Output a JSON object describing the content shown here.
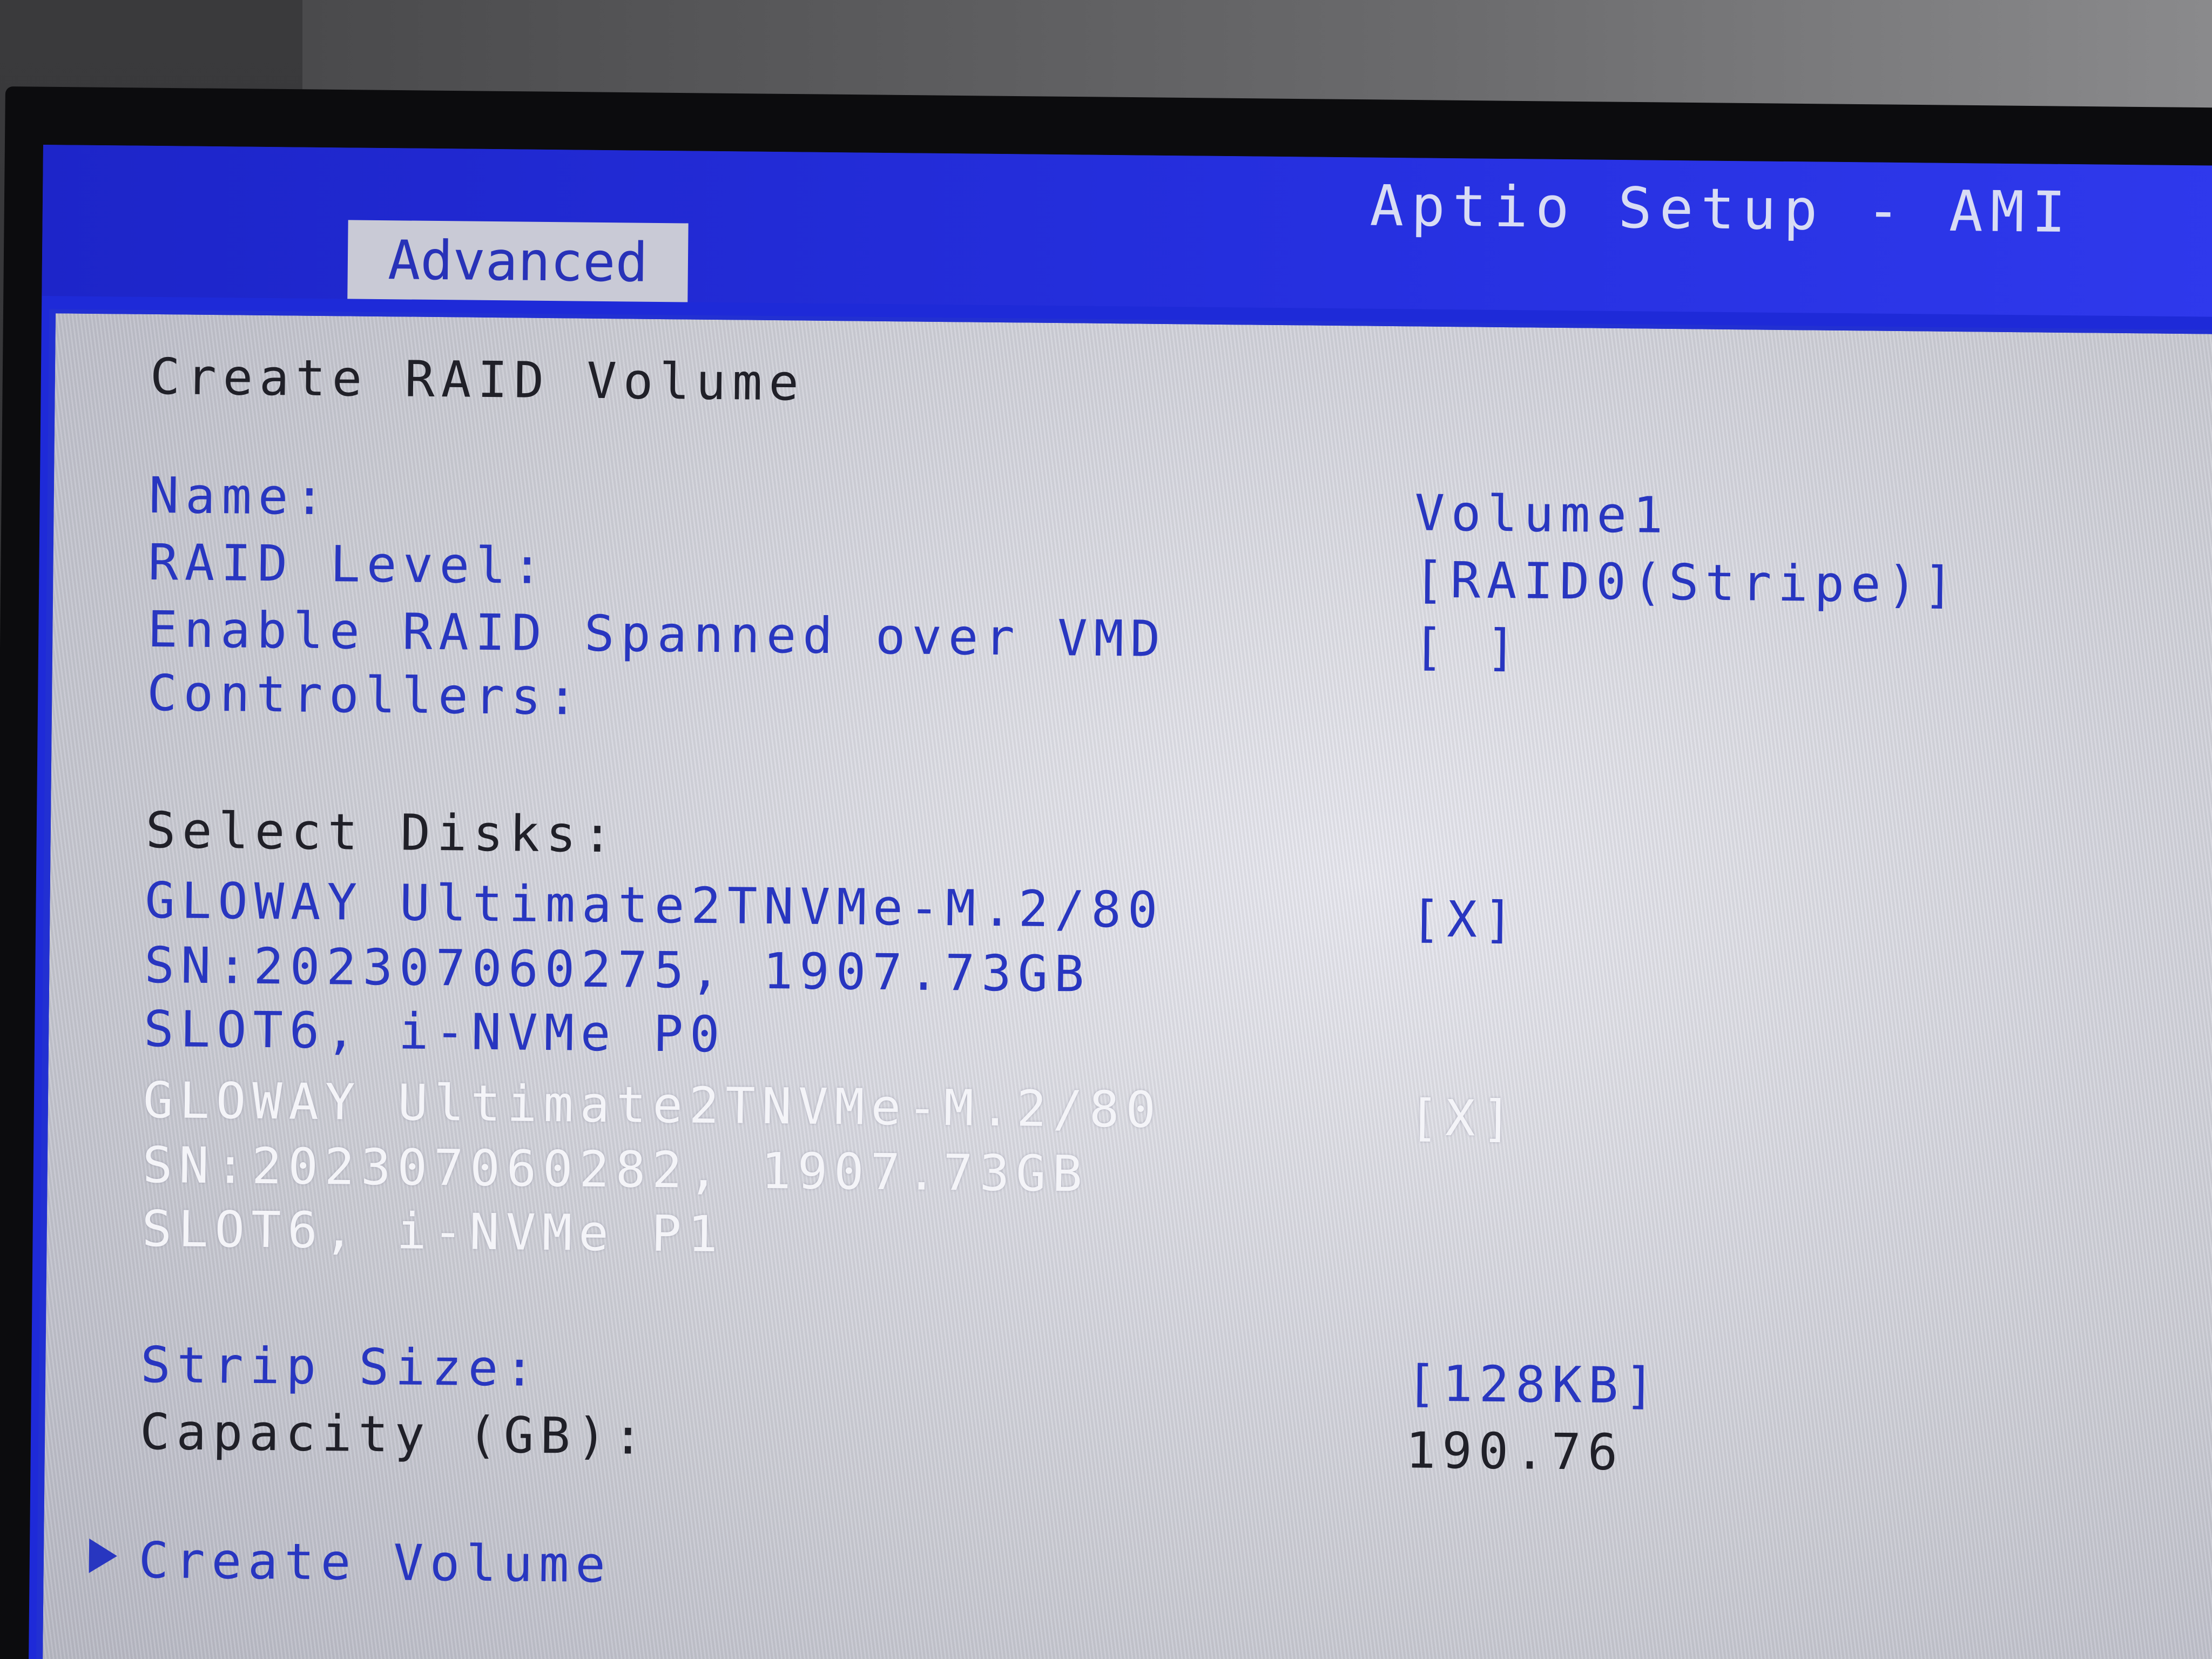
{
  "header": {
    "app_title": "Aptio Setup - AMI",
    "active_tab": "Advanced"
  },
  "form": {
    "title": "Create RAID Volume",
    "name_label": "Name:",
    "name_value": "Volume1",
    "raid_level_label": "RAID Level:",
    "raid_level_value": "[RAID0(Stripe)]",
    "vmd_label_line1": "Enable RAID Spanned over VMD",
    "vmd_label_line2": "Controllers:",
    "vmd_value": "[ ]",
    "select_disks_label": "Select Disks:",
    "disks": [
      {
        "line1": "GLOWAY Ultimate2TNVMe-M.2/80",
        "line2": "SN:202307060275, 1907.73GB",
        "line3": "SLOT6, i-NVMe P0",
        "checkbox": "[X]"
      },
      {
        "line1": "GLOWAY Ultimate2TNVMe-M.2/80",
        "line2": "SN:202307060282, 1907.73GB",
        "line3": "SLOT6, i-NVMe P1",
        "checkbox": "[X]"
      }
    ],
    "strip_size_label": "Strip Size:",
    "strip_size_value": "[128KB]",
    "capacity_label": "Capacity (GB):",
    "capacity_value": "190.76",
    "create_volume_label": "Create Volume"
  }
}
